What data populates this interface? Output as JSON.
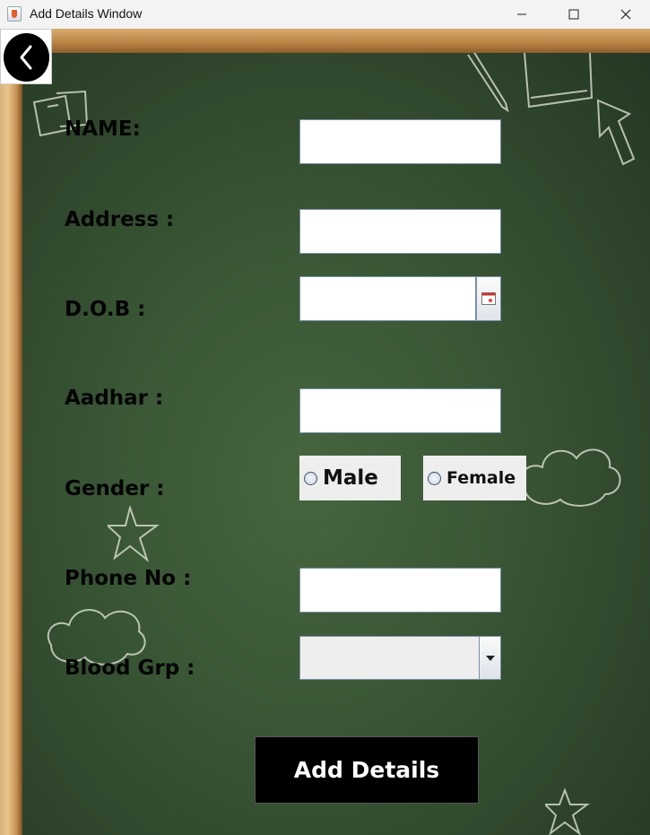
{
  "window": {
    "title": "Add Details Window",
    "controls": {
      "minimize": "minimize",
      "maximize": "maximize",
      "close": "close"
    }
  },
  "back_button": {
    "icon": "chevron-left-icon"
  },
  "form": {
    "name_label": "NAME:",
    "address_label": "Address :",
    "dob_label": "D.O.B :",
    "aadhar_label": "Aadhar :",
    "gender_label": "Gender :",
    "phone_label": "Phone No :",
    "blood_label": "Blood Grp :",
    "name_value": "",
    "address_value": "",
    "dob_value": "",
    "aadhar_value": "",
    "phone_value": "",
    "gender_options": {
      "male": "Male",
      "female": "Female"
    },
    "blood_group_selected": "",
    "submit_label": "Add Details"
  },
  "colors": {
    "board": "#3a5636",
    "button_bg": "#000000",
    "field_border": "#7a8fa8"
  }
}
